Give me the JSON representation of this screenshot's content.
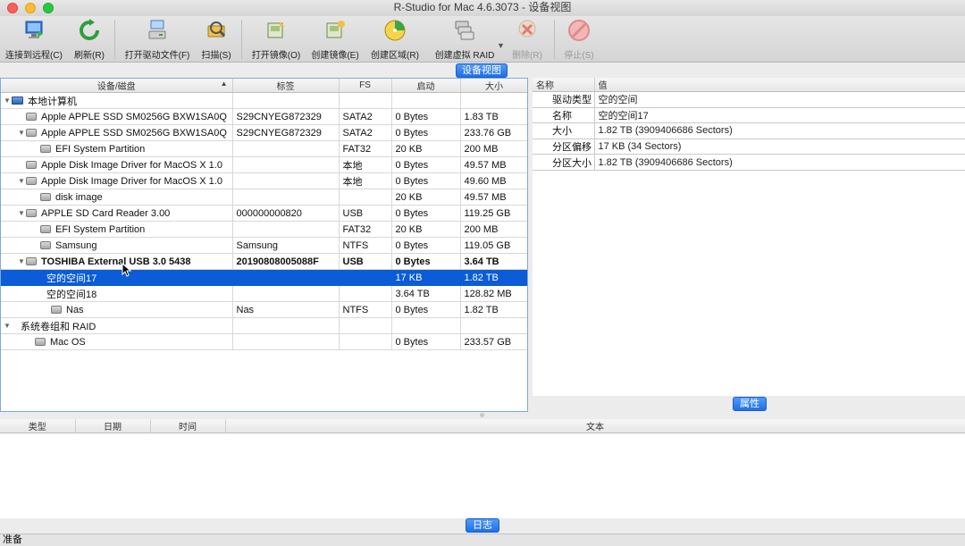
{
  "window": {
    "title": "R-Studio for Mac 4.6.3073 - 设备视图"
  },
  "toolbar": {
    "connect": {
      "label": "连接到远程(C)",
      "icon": "monitor-connect-icon"
    },
    "refresh": {
      "label": "刷新(R)",
      "icon": "refresh-icon"
    },
    "open_drive_files": {
      "label": "打开驱动文件(F)",
      "icon": "open-drive-files-icon"
    },
    "scan": {
      "label": "扫描(S)",
      "icon": "scan-icon"
    },
    "open_image": {
      "label": "打开镜像(O)",
      "icon": "open-image-icon"
    },
    "create_image": {
      "label": "创建镜像(E)",
      "icon": "create-image-icon"
    },
    "create_region": {
      "label": "创建区域(R)",
      "icon": "create-region-icon"
    },
    "create_raid": {
      "label": "创建虚拟 RAID",
      "icon": "create-raid-icon"
    },
    "delete": {
      "label": "删除(R)",
      "icon": "delete-icon"
    },
    "stop": {
      "label": "停止(S)",
      "icon": "stop-icon"
    }
  },
  "panes": {
    "device_view_tab": "设备视图",
    "properties_tab": "属性",
    "log_tab": "日志"
  },
  "device_table": {
    "columns": [
      "设备/磁盘",
      "标签",
      "FS",
      "启动",
      "大小"
    ],
    "rows": [
      {
        "name": "本地计算机",
        "label": "",
        "fs": "",
        "start": "",
        "size": ""
      },
      {
        "name": "Apple APPLE SSD SM0256G BXW1SA0Q",
        "label": "S29CNYEG872329",
        "fs": "SATA2",
        "start": "0 Bytes",
        "size": "1.83 TB"
      },
      {
        "name": "Apple APPLE SSD SM0256G BXW1SA0Q",
        "label": "S29CNYEG872329",
        "fs": "SATA2",
        "start": "0 Bytes",
        "size": "233.76 GB"
      },
      {
        "name": "EFI System Partition",
        "label": "",
        "fs": "FAT32",
        "start": "20 KB",
        "size": "200 MB"
      },
      {
        "name": "Apple Disk Image Driver for MacOS X 1.0",
        "label": "",
        "fs": "本地",
        "start": "0 Bytes",
        "size": "49.57 MB"
      },
      {
        "name": "Apple Disk Image Driver for MacOS X 1.0",
        "label": "",
        "fs": "本地",
        "start": "0 Bytes",
        "size": "49.60 MB"
      },
      {
        "name": "disk image",
        "label": "",
        "fs": "",
        "start": "20 KB",
        "size": "49.57 MB"
      },
      {
        "name": "APPLE SD Card Reader 3.00",
        "label": "000000000820",
        "fs": "USB",
        "start": "0 Bytes",
        "size": "119.25 GB"
      },
      {
        "name": "EFI System Partition",
        "label": "",
        "fs": "FAT32",
        "start": "20 KB",
        "size": "200 MB"
      },
      {
        "name": "Samsung",
        "label": "Samsung",
        "fs": "NTFS",
        "start": "0 Bytes",
        "size": "119.05 GB"
      },
      {
        "name": "TOSHIBA External USB 3.0 5438",
        "label": "20190808005088F",
        "fs": "USB",
        "start": "0 Bytes",
        "size": "3.64 TB"
      },
      {
        "name": "空的空间17",
        "label": "",
        "fs": "",
        "start": "17 KB",
        "size": "1.82 TB"
      },
      {
        "name": "空的空间18",
        "label": "",
        "fs": "",
        "start": "3.64 TB",
        "size": "128.82 MB"
      },
      {
        "name": "Nas",
        "label": "Nas",
        "fs": "NTFS",
        "start": "0 Bytes",
        "size": "1.82 TB"
      },
      {
        "name": "系统卷组和 RAID",
        "label": "",
        "fs": "",
        "start": "",
        "size": ""
      },
      {
        "name": "Mac OS",
        "label": "",
        "fs": "",
        "start": "0 Bytes",
        "size": "233.57 GB"
      }
    ]
  },
  "properties": {
    "columns": [
      "名称",
      "值"
    ],
    "rows": [
      {
        "key": "驱动类型",
        "value": "空的空间"
      },
      {
        "key": "名称",
        "value": "空的空间17"
      },
      {
        "key": "大小",
        "value": "1.82 TB (3909406686 Sectors)"
      },
      {
        "key": "分区偏移",
        "value": "17 KB (34 Sectors)"
      },
      {
        "key": "分区大小",
        "value": "1.82 TB (3909406686 Sectors)"
      }
    ]
  },
  "log": {
    "columns": [
      "类型",
      "日期",
      "时间",
      "文本"
    ]
  },
  "status": {
    "text": "准备"
  },
  "colors": {
    "selection": "#0b5cd6",
    "tab_blue": "#1f6fe6"
  }
}
